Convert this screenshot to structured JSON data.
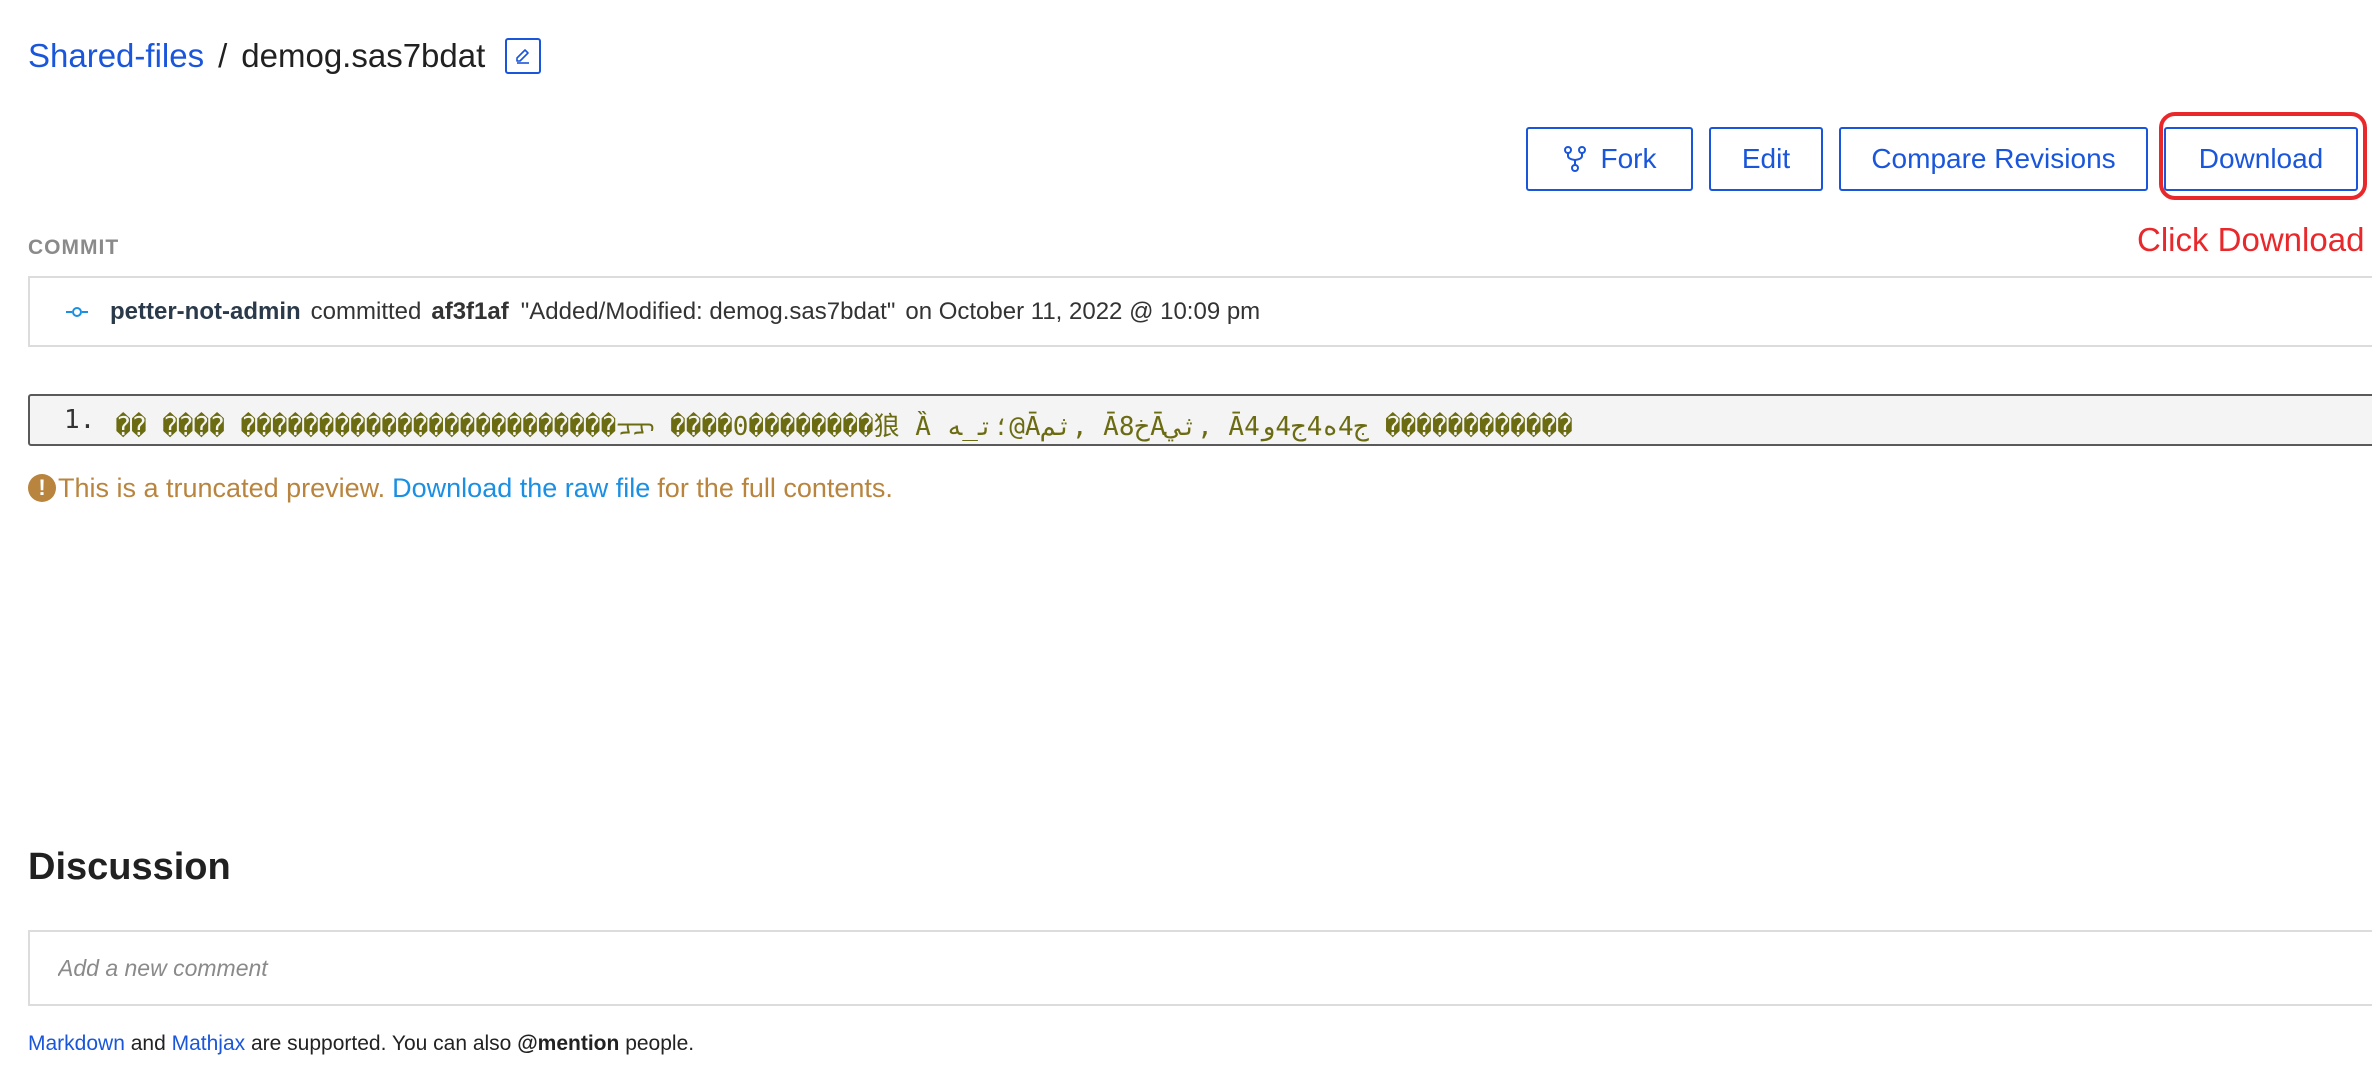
{
  "breadcrumb": {
    "root": "Shared-files",
    "separator": "/",
    "current": "demog.sas7bdat"
  },
  "actions": {
    "fork": "Fork",
    "edit": "Edit",
    "compare": "Compare Revisions",
    "download": "Download"
  },
  "annotation": {
    "text": "Click Download",
    "color": "#e8282b"
  },
  "commit": {
    "label": "COMMIT",
    "user": "petter-not-admin",
    "verb": "committed",
    "hash": "af3f1af",
    "message": "\"Added/Modified: demog.sas7bdat\"",
    "date": "on October 11, 2022 @ 10:09 pm"
  },
  "preview": {
    "line_number": "1.",
    "content": "�� ���� ������������������������ᠴᠴ ����0��������狼    Ȁ ؛ت̲ه@Āثم, Ā8خĀثي, Ā4ج4ه4ج4و ������������"
  },
  "truncated": {
    "icon": "!",
    "before": "This is a truncated preview.",
    "link": "Download the raw file",
    "after": "for the full contents."
  },
  "discussion": {
    "title": "Discussion",
    "placeholder": "Add a new comment",
    "markdown": "Markdown",
    "and": "and",
    "mathjax": "Mathjax",
    "supported": "are supported. You can also",
    "mention": "@mention",
    "people": "people."
  },
  "colors": {
    "primary": "#1a56db",
    "warning": "#b8843e",
    "highlight": "#e8282b",
    "link": "#1a8fe3"
  }
}
